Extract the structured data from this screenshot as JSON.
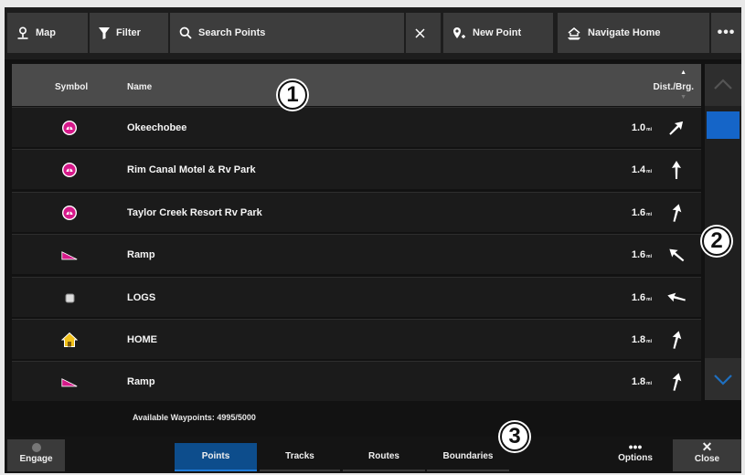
{
  "toolbar": {
    "map_label": "Map",
    "filter_label": "Filter",
    "search_placeholder": "Search Points",
    "new_point_label": "New Point",
    "navigate_home_label": "Navigate Home",
    "more_label": "•••"
  },
  "table": {
    "headers": {
      "symbol": "Symbol",
      "name": "Name",
      "dist": "Dist./Brg."
    },
    "rows": [
      {
        "symbol": "pink-buoy-icon",
        "name": "Okeechobee",
        "dist": "1.0",
        "unit": "mi",
        "bearing_deg": 45
      },
      {
        "symbol": "pink-buoy-icon",
        "name": "Rim Canal Motel & Rv Park",
        "dist": "1.4",
        "unit": "mi",
        "bearing_deg": 0
      },
      {
        "symbol": "pink-buoy-icon",
        "name": "Taylor Creek Resort Rv Park",
        "dist": "1.6",
        "unit": "mi",
        "bearing_deg": 15
      },
      {
        "symbol": "ramp-icon",
        "name": "Ramp",
        "dist": "1.6",
        "unit": "mi",
        "bearing_deg": -50
      },
      {
        "symbol": "square-waypoint-icon",
        "name": "LOGS",
        "dist": "1.6",
        "unit": "mi",
        "bearing_deg": -75
      },
      {
        "symbol": "home-icon",
        "name": "HOME",
        "dist": "1.8",
        "unit": "mi",
        "bearing_deg": 15
      },
      {
        "symbol": "ramp-icon",
        "name": "Ramp",
        "dist": "1.8",
        "unit": "mi",
        "bearing_deg": 15
      }
    ]
  },
  "available_waypoints": "Available Waypoints: 4995/5000",
  "bottom": {
    "engage_label": "Engage",
    "tabs": [
      "Points",
      "Tracks",
      "Routes",
      "Boundaries"
    ],
    "selected_tab": "Points",
    "options_label": "Options",
    "options_dots": "•••",
    "close_label": "Close",
    "close_glyph": "✕"
  },
  "callouts": [
    "1",
    "2",
    "3"
  ],
  "colors": {
    "accent": "#1565c8",
    "selected_tab": "#0d4d8c",
    "waypoint_pink": "#d6198a"
  }
}
